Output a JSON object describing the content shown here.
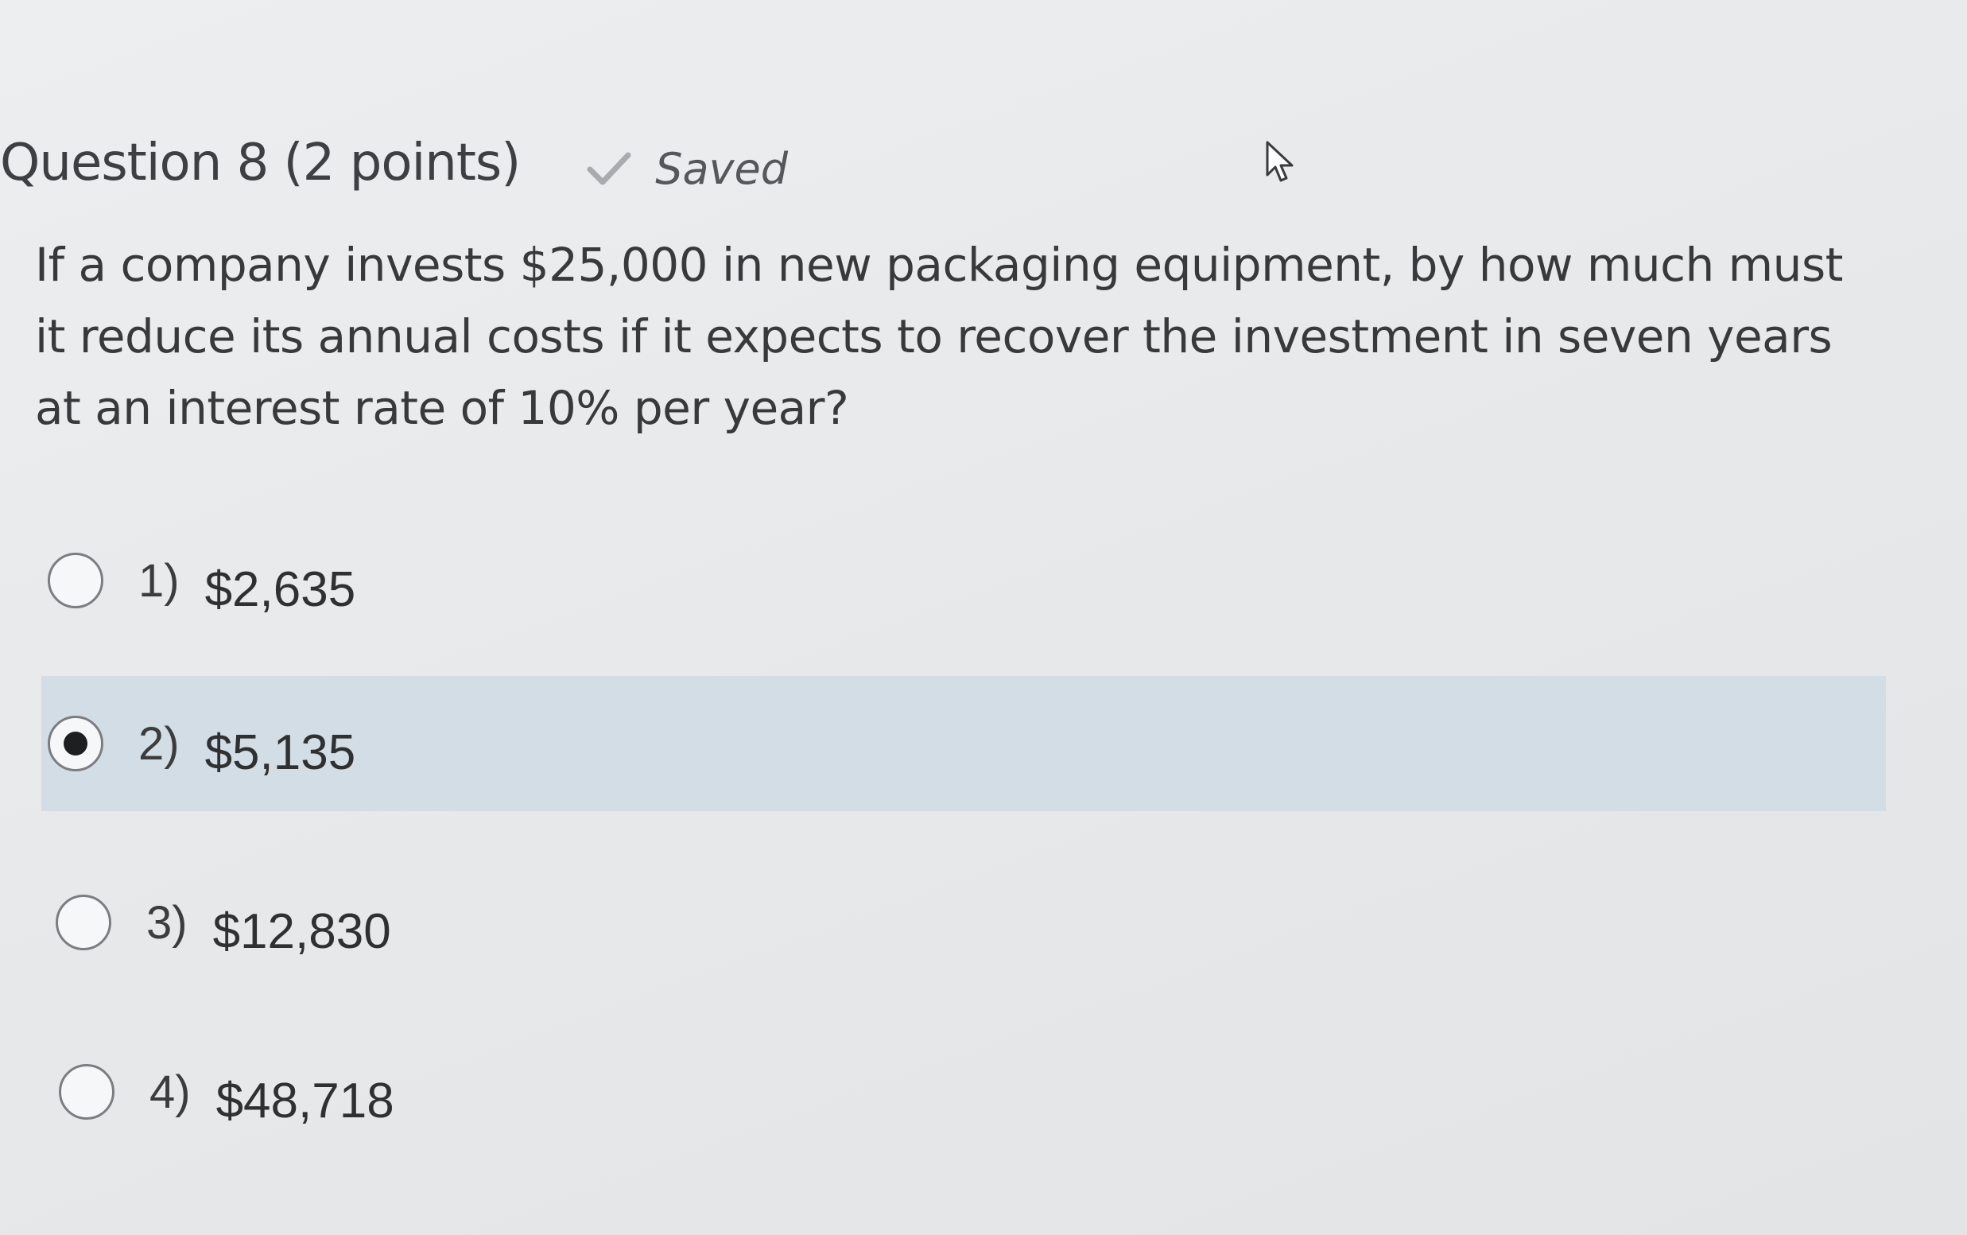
{
  "question": {
    "title": "Question 8",
    "points": "(2 points)",
    "status_label": "Saved",
    "text": "If a company invests $25,000 in new packaging equipment, by how much must it reduce its annual costs if it expects to recover the investment in seven years at an interest rate of 10% per year?"
  },
  "options": [
    {
      "number": "1)",
      "value": "$2,635",
      "selected": false
    },
    {
      "number": "2)",
      "value": "$5,135",
      "selected": true
    },
    {
      "number": "3)",
      "value": "$12,830",
      "selected": false
    },
    {
      "number": "4)",
      "value": "$48,718",
      "selected": false
    }
  ],
  "colors": {
    "selected_row": "#d3dde6",
    "background": "#e7e9eb",
    "text": "#3a3b3d"
  },
  "icons": {
    "saved": "check-icon",
    "pointer": "mouse-cursor-icon"
  }
}
